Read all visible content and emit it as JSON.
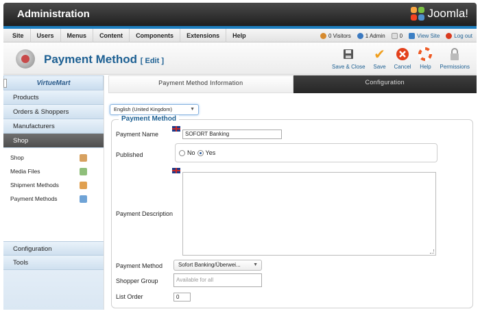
{
  "header": {
    "title": "Administration",
    "brand": "Joomla!"
  },
  "menu": {
    "items": [
      "Site",
      "Users",
      "Menus",
      "Content",
      "Components",
      "Extensions",
      "Help"
    ],
    "status": {
      "visitors": "0 Visitors",
      "admins": "1 Admin",
      "messages": "0",
      "view_site": "View Site",
      "logout": "Log out"
    }
  },
  "toolbar": {
    "page_title": "Payment Method",
    "page_subtitle": "[ Edit ]",
    "buttons": [
      {
        "label": "Save & Close",
        "icon": "save-close-icon"
      },
      {
        "label": "Save",
        "icon": "check-icon"
      },
      {
        "label": "Cancel",
        "icon": "cancel-icon"
      },
      {
        "label": "Help",
        "icon": "help-icon"
      },
      {
        "label": "Permissions",
        "icon": "lock-icon"
      }
    ]
  },
  "sidebar": {
    "logo": "VirtueMart",
    "sections": [
      "Products",
      "Orders & Shoppers",
      "Manufacturers",
      "Shop"
    ],
    "active_section": "Shop",
    "shop_items": [
      {
        "label": "Shop",
        "icon": "shop-icon"
      },
      {
        "label": "Media Files",
        "icon": "media-icon"
      },
      {
        "label": "Shipment Methods",
        "icon": "truck-icon"
      },
      {
        "label": "Payment Methods",
        "icon": "payment-icon"
      }
    ],
    "bottom_sections": [
      "Configuration",
      "Tools"
    ]
  },
  "tabs": [
    {
      "label": "Payment Method Information",
      "active": true
    },
    {
      "label": "Configuration",
      "active": false
    }
  ],
  "form": {
    "language": "English (United Kingdom)",
    "legend": "Payment Method",
    "payment_name_label": "Payment Name",
    "payment_name_value": "SOFORT Banking",
    "published_label": "Published",
    "published_no": "No",
    "published_yes": "Yes",
    "published_value": "Yes",
    "description_label": "Payment Description",
    "description_value": "",
    "method_label": "Payment Method",
    "method_value": "Sofort Banking/Überwei...",
    "shopper_group_label": "Shopper Group",
    "shopper_group_placeholder": "Available for all",
    "list_order_label": "List Order",
    "list_order_value": "0"
  },
  "colors": {
    "accent": "#1c5f92",
    "header_dark": "#2a2a2a",
    "blue_line": "#1e7fc0"
  }
}
